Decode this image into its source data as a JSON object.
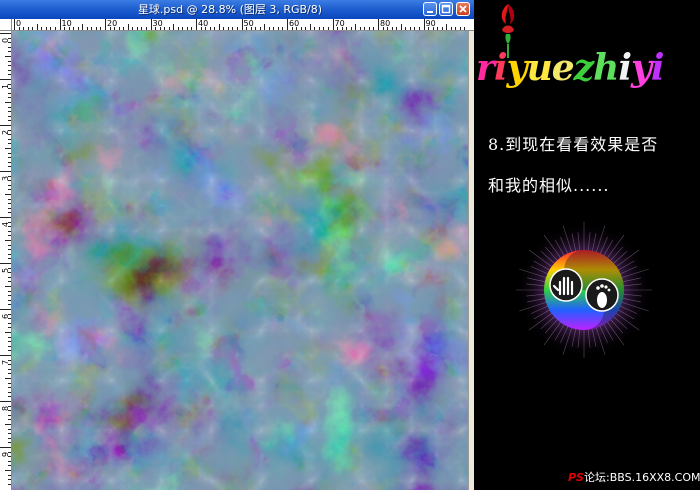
{
  "window": {
    "title": "星球.psd @ 28.8% (图层 3, RGB/8)",
    "controls": {
      "minimize_icon": "minimize-icon",
      "maximize_icon": "maximize-icon",
      "close_icon": "close-icon"
    }
  },
  "rulers": {
    "top_labels": [
      "0",
      "10",
      "20",
      "30",
      "40",
      "50",
      "60",
      "70",
      "80",
      "90"
    ],
    "left_labels": [
      "0",
      "1",
      "2",
      "3",
      "4",
      "5",
      "6",
      "7",
      "8",
      "9"
    ]
  },
  "colors": {
    "titlebar": "#1f5fd0",
    "nebula_blue": "#2a4f6e",
    "cloud_white": "#d8d8d8"
  },
  "panel": {
    "brand_letters": [
      {
        "char": "r",
        "color": "#ff2aa0"
      },
      {
        "char": "i",
        "color": "#ff3b5c"
      },
      {
        "char": "y",
        "color": "#ffd400"
      },
      {
        "char": "u",
        "color": "#ffe640"
      },
      {
        "char": "e",
        "color": "#f4e86a"
      },
      {
        "char": "z",
        "color": "#3ccf3c"
      },
      {
        "char": "h",
        "color": "#5ee05e"
      },
      {
        "char": "i",
        "color": "#f3f3f3"
      },
      {
        "char": "y",
        "color": "#ff40e0"
      },
      {
        "char": "i",
        "color": "#c030ff"
      }
    ],
    "step_line1": "8.到现在看看效果是否",
    "step_line2": "和我的相似......",
    "logo_icon": "hand-foot-logo-icon",
    "flower_icon": "rose-icon"
  },
  "footer": {
    "ps": "PS",
    "rest": "论坛:BBS.16XX8.COM"
  }
}
